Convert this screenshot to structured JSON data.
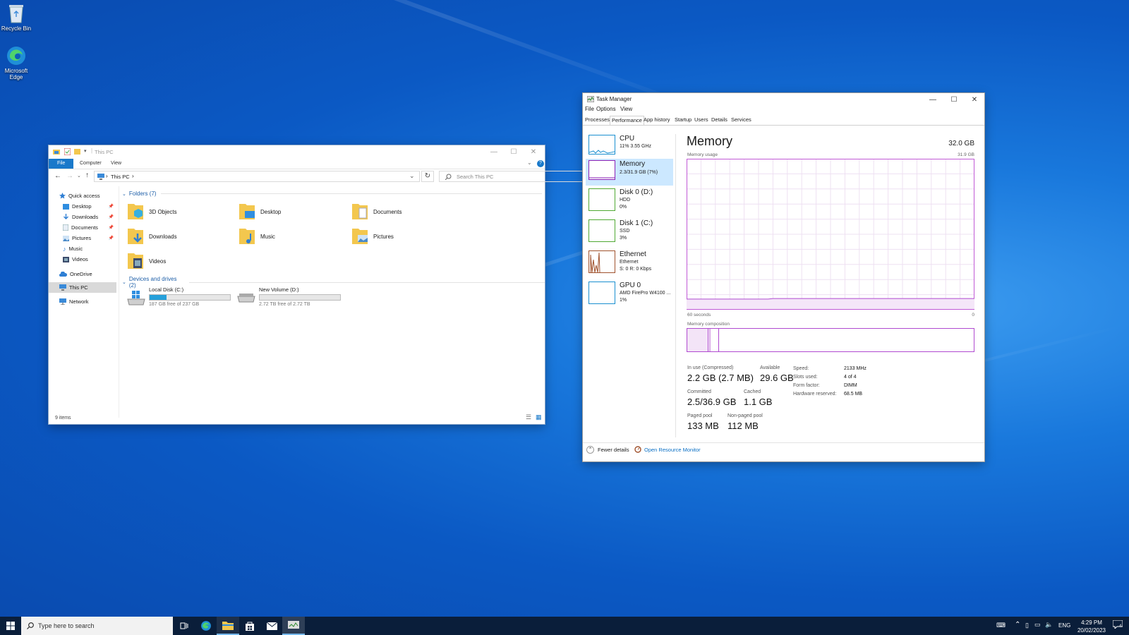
{
  "desktop": {
    "icons": [
      {
        "label": "Recycle Bin"
      },
      {
        "label": "Microsoft Edge"
      }
    ]
  },
  "explorer": {
    "title": "This PC",
    "ribbon": {
      "file": "File",
      "computer": "Computer",
      "view": "View"
    },
    "address": {
      "location": "This PC",
      "search_placeholder": "Search This PC"
    },
    "nav": {
      "quick_access": "Quick access",
      "quick_items": [
        "Desktop",
        "Downloads",
        "Documents",
        "Pictures",
        "Music",
        "Videos"
      ],
      "onedrive": "OneDrive",
      "this_pc": "This PC",
      "network": "Network"
    },
    "folders_header": "Folders (7)",
    "folders": [
      "3D Objects",
      "Desktop",
      "Documents",
      "Downloads",
      "Music",
      "Pictures",
      "Videos"
    ],
    "drives_header": "Devices and drives (2)",
    "drives": [
      {
        "name": "Local Disk (C:)",
        "free": "187 GB free of 237 GB",
        "used_fraction": 0.21
      },
      {
        "name": "New Volume (D:)",
        "free": "2.72 TB free of 2.72 TB",
        "used_fraction": 0.0
      }
    ],
    "status": "9 items"
  },
  "taskmgr": {
    "title": "Task Manager",
    "menu": [
      "File",
      "Options",
      "View"
    ],
    "tabs": [
      "Processes",
      "Performance",
      "App history",
      "Startup",
      "Users",
      "Details",
      "Services"
    ],
    "active_tab": "Performance",
    "sidebar": [
      {
        "title": "CPU",
        "line1": "11% 3.55 GHz",
        "line2": "",
        "color": "#1a8fd0"
      },
      {
        "title": "Memory",
        "line1": "2.3/31.9 GB (7%)",
        "line2": "",
        "color": "#8b22b5"
      },
      {
        "title": "Disk 0 (D:)",
        "line1": "HDD",
        "line2": "0%",
        "color": "#4fa832"
      },
      {
        "title": "Disk 1 (C:)",
        "line1": "SSD",
        "line2": "3%",
        "color": "#4fa832"
      },
      {
        "title": "Ethernet",
        "line1": "Ethernet",
        "line2": "S: 0 R: 0 Kbps",
        "color": "#a0522d"
      },
      {
        "title": "GPU 0",
        "line1": "AMD FirePro W4100 ...",
        "line2": "1%",
        "color": "#1a8fd0"
      }
    ],
    "memory": {
      "heading": "Memory",
      "total": "32.0 GB",
      "usage_label": "Memory usage",
      "usage_max": "31.9 GB",
      "time_left": "60 seconds",
      "time_right": "0",
      "composition_label": "Memory composition",
      "usage_fraction": 0.07,
      "stats": {
        "in_use_label": "In use (Compressed)",
        "in_use": "2.2 GB (2.7 MB)",
        "available_label": "Available",
        "available": "29.6 GB",
        "committed_label": "Committed",
        "committed": "2.5/36.9 GB",
        "cached_label": "Cached",
        "cached": "1.1 GB",
        "paged_label": "Paged pool",
        "paged": "133 MB",
        "nonpaged_label": "Non-paged pool",
        "nonpaged": "112 MB"
      },
      "details": [
        {
          "label": "Speed:",
          "value": "2133 MHz"
        },
        {
          "label": "Slots used:",
          "value": "4 of 4"
        },
        {
          "label": "Form factor:",
          "value": "DIMM"
        },
        {
          "label": "Hardware reserved:",
          "value": "68.5 MB"
        }
      ]
    },
    "footer": {
      "fewer": "Fewer details",
      "resource_monitor": "Open Resource Monitor"
    }
  },
  "taskbar": {
    "search_placeholder": "Type here to search",
    "lang": "ENG",
    "time": "4:29 PM",
    "date": "20/02/2023",
    "notification_count": "4"
  }
}
